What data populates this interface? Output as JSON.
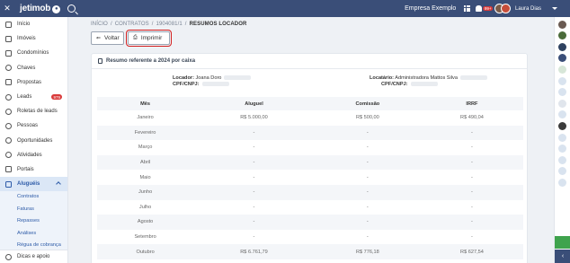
{
  "topbar": {
    "logo": "jetimob",
    "company": "Empresa Exemplo",
    "notifications": "99+",
    "user": "Laura Dias"
  },
  "sidebar": {
    "items": [
      {
        "label": "Início",
        "icon": "grid-icon"
      },
      {
        "label": "Imóveis",
        "icon": "house-icon"
      },
      {
        "label": "Condomínios",
        "icon": "building-icon"
      },
      {
        "label": "Chaves",
        "icon": "key-icon"
      },
      {
        "label": "Propostas",
        "icon": "pen-icon"
      },
      {
        "label": "Leads",
        "icon": "share-icon",
        "badge": "979"
      },
      {
        "label": "Roletas de leads",
        "icon": "refresh-icon"
      },
      {
        "label": "Pessoas",
        "icon": "people-icon"
      },
      {
        "label": "Oportunidades",
        "icon": "target-icon"
      },
      {
        "label": "Atividades",
        "icon": "check-circle-icon"
      },
      {
        "label": "Portais",
        "icon": "megaphone-icon"
      },
      {
        "label": "Aluguéis",
        "icon": "book-icon"
      }
    ],
    "sub_items": [
      "Contratos",
      "Faturas",
      "Repasses",
      "Análises",
      "Régua de cobrança"
    ],
    "footer": "Dicas e apoio"
  },
  "breadcrumb": [
    "INÍCIO",
    "CONTRATOS",
    "1904081/1",
    "RESUMOS LOCADOR"
  ],
  "buttons": {
    "back": "Voltar",
    "print": "Imprimir"
  },
  "card": {
    "title": "Resumo referente a 2024 por caixa",
    "locador_label": "Locador:",
    "locador_name": "Joana Doro",
    "cpf_label": "CPF/CNPJ:",
    "locatario_label": "Locatário:",
    "locatario_name": "Administradora Mattos Silva",
    "cpf_label2": "CPF/CNPJ:"
  },
  "table": {
    "headers": [
      "Mês",
      "Aluguel",
      "Comissão",
      "IRRF"
    ],
    "rows": [
      [
        "Janeiro",
        "R$ 5.000,00",
        "R$ 500,00",
        "R$ 490,04"
      ],
      [
        "Fevereiro",
        "-",
        "-",
        "-"
      ],
      [
        "Março",
        "-",
        "-",
        "-"
      ],
      [
        "Abril",
        "-",
        "-",
        "-"
      ],
      [
        "Maio",
        "-",
        "-",
        "-"
      ],
      [
        "Junho",
        "-",
        "-",
        "-"
      ],
      [
        "Julho",
        "-",
        "-",
        "-"
      ],
      [
        "Agosto",
        "-",
        "-",
        "-"
      ],
      [
        "Setembro",
        "-",
        "-",
        "-"
      ],
      [
        "Outubro",
        "R$ 6.761,79",
        "R$ 776,18",
        "R$ 627,54"
      ]
    ]
  },
  "colors": {
    "topbar": "#3a4e78",
    "accent": "#2d5ba8",
    "badge": "#d93a3a",
    "highlight": "#d42020"
  }
}
